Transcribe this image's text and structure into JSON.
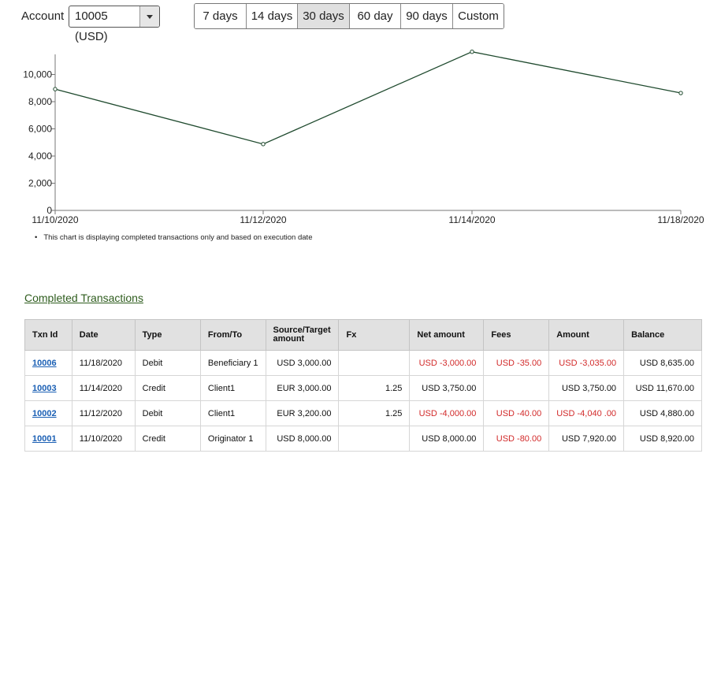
{
  "account": {
    "label": "Account",
    "selected": "10005 (USD)"
  },
  "range_buttons": [
    "7 days",
    "14 days",
    "30 days",
    "60 day",
    "90 days",
    "Custom"
  ],
  "range_active": "30 days",
  "chart_data": {
    "type": "line",
    "x": [
      "11/10/2020",
      "11/12/2020",
      "11/14/2020",
      "11/18/2020"
    ],
    "series": [
      {
        "values": [
          8920,
          4880,
          11670,
          8635
        ],
        "color": "#1f4a2e"
      }
    ],
    "y_ticks": [
      "0",
      "2,000",
      "4,000",
      "6,000",
      "8,000",
      "10,000"
    ],
    "ylim": [
      0,
      12000
    ],
    "grid": false
  },
  "chart_note": "This chart is displaying completed transactions only and based on execution date",
  "section_title": "Completed Transactions",
  "table": {
    "headers": [
      "Txn Id",
      "Date",
      "Type",
      "From/To",
      "Source/Target amount",
      "Fx",
      "Net amount",
      "Fees",
      "Amount",
      "Balance"
    ],
    "rows": [
      [
        "10006",
        "11/18/2020",
        "Debit",
        "Beneficiary 1",
        "USD 3,000.00",
        "",
        "USD -3,000.00",
        "USD -35.00",
        "USD -3,035.00",
        "USD 8,635.00"
      ],
      [
        "10003",
        "11/14/2020",
        "Credit",
        "Client1",
        "EUR 3,000.00",
        "1.25",
        "USD 3,750.00",
        "",
        "USD 3,750.00",
        "USD 11,670.00"
      ],
      [
        "10002",
        "11/12/2020",
        "Debit",
        "Client1",
        "EUR 3,200.00",
        "1.25",
        "USD -4,000.00",
        "USD -40.00",
        "USD -4,040 .00",
        "USD 4,880.00"
      ],
      [
        "10001",
        "11/10/2020",
        "Credit",
        "Originator 1",
        "USD 8,000.00",
        "",
        "USD 8,000.00",
        "USD -80.00",
        "USD 7,920.00",
        "USD 8,920.00"
      ]
    ]
  },
  "colors": {
    "line": "#1f4a2e",
    "link": "#1a5fb4",
    "negative": "#d22a2a",
    "section_link": "#2f5d1e"
  }
}
